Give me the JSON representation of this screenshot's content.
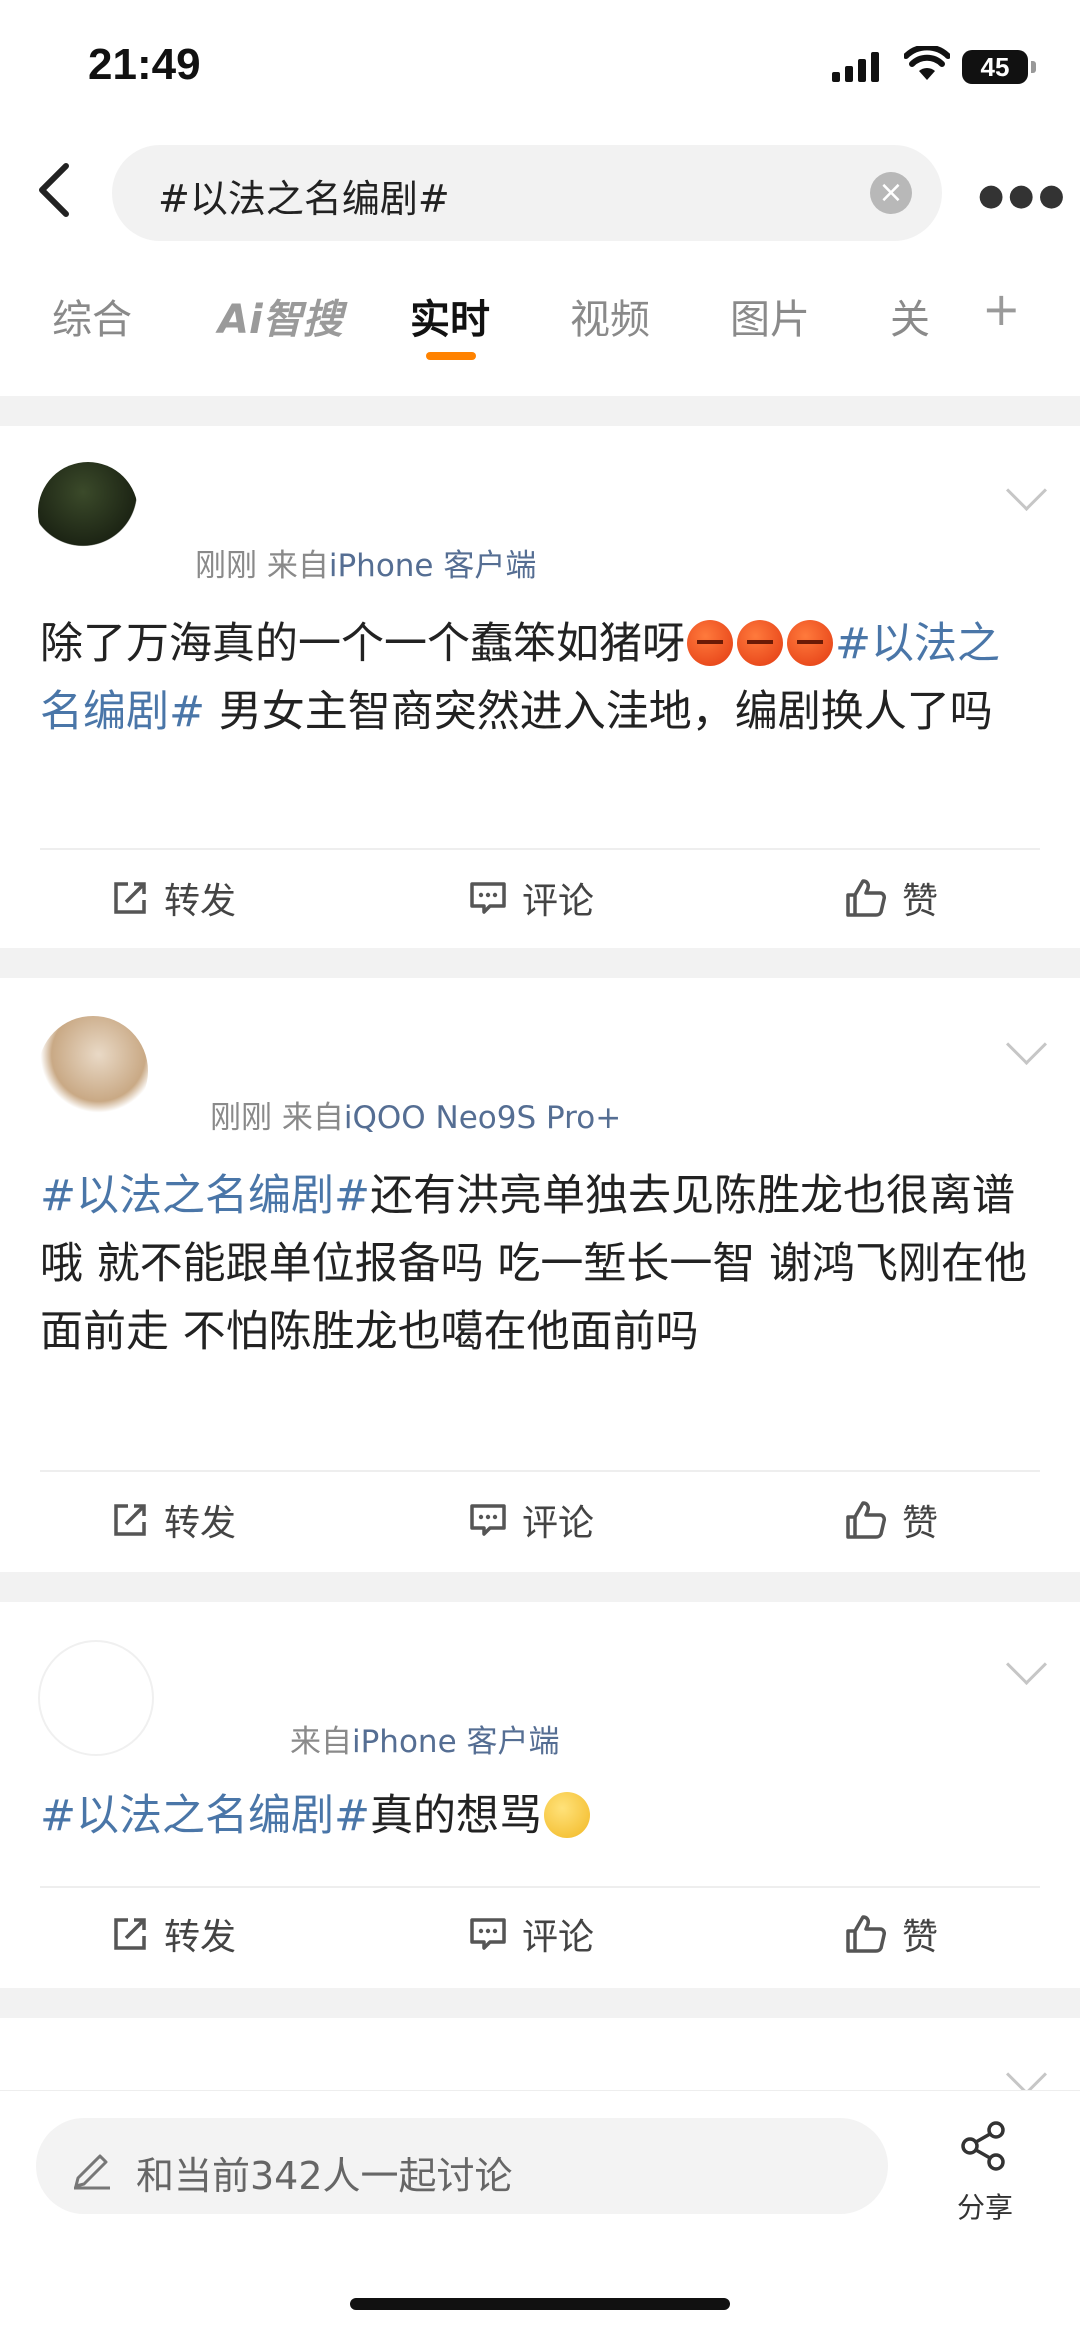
{
  "status_bar": {
    "time": "21:49",
    "battery": "45"
  },
  "search": {
    "query": "#以法之名编剧#"
  },
  "tabs": [
    {
      "label": "综合"
    },
    {
      "label": "Ai智搜"
    },
    {
      "label": "实时"
    },
    {
      "label": "视频"
    },
    {
      "label": "图片"
    },
    {
      "label": "关"
    }
  ],
  "posts": [
    {
      "time": "刚刚",
      "source_prefix": "来自",
      "source": "iPhone 客户端",
      "text_a": "除了万海真的一个一个蠢笨如猪呀",
      "emoji": [
        "angry-face-icon",
        "angry-face-icon",
        "angry-face-icon"
      ],
      "topic": "#以法之名编剧#",
      "text_b": " 男女主智商突然进入洼地，编剧换人了吗",
      "actions": {
        "repost": "转发",
        "comment": "评论",
        "like": "赞"
      }
    },
    {
      "time": "刚刚",
      "source_prefix": "来自",
      "source": "iQOO Neo9S Pro+",
      "topic": "#以法之名编剧#",
      "text": "还有洪亮单独去见陈胜龙也很离谱哦 就不能跟单位报备吗 吃一堑长一智 谢鸿飞刚在他面前走 不怕陈胜龙也噶在他面前吗",
      "actions": {
        "repost": "转发",
        "comment": "评论",
        "like": "赞"
      }
    },
    {
      "source_prefix": "来自",
      "source": "iPhone 客户端",
      "topic": "#以法之名编剧#",
      "text": "真的想骂",
      "emoji": [
        "eye-roll-face-icon"
      ],
      "actions": {
        "repost": "转发",
        "comment": "评论",
        "like": "赞"
      }
    }
  ],
  "bottom": {
    "discuss_placeholder": "和当前342人一起讨论",
    "share_label": "分享"
  }
}
